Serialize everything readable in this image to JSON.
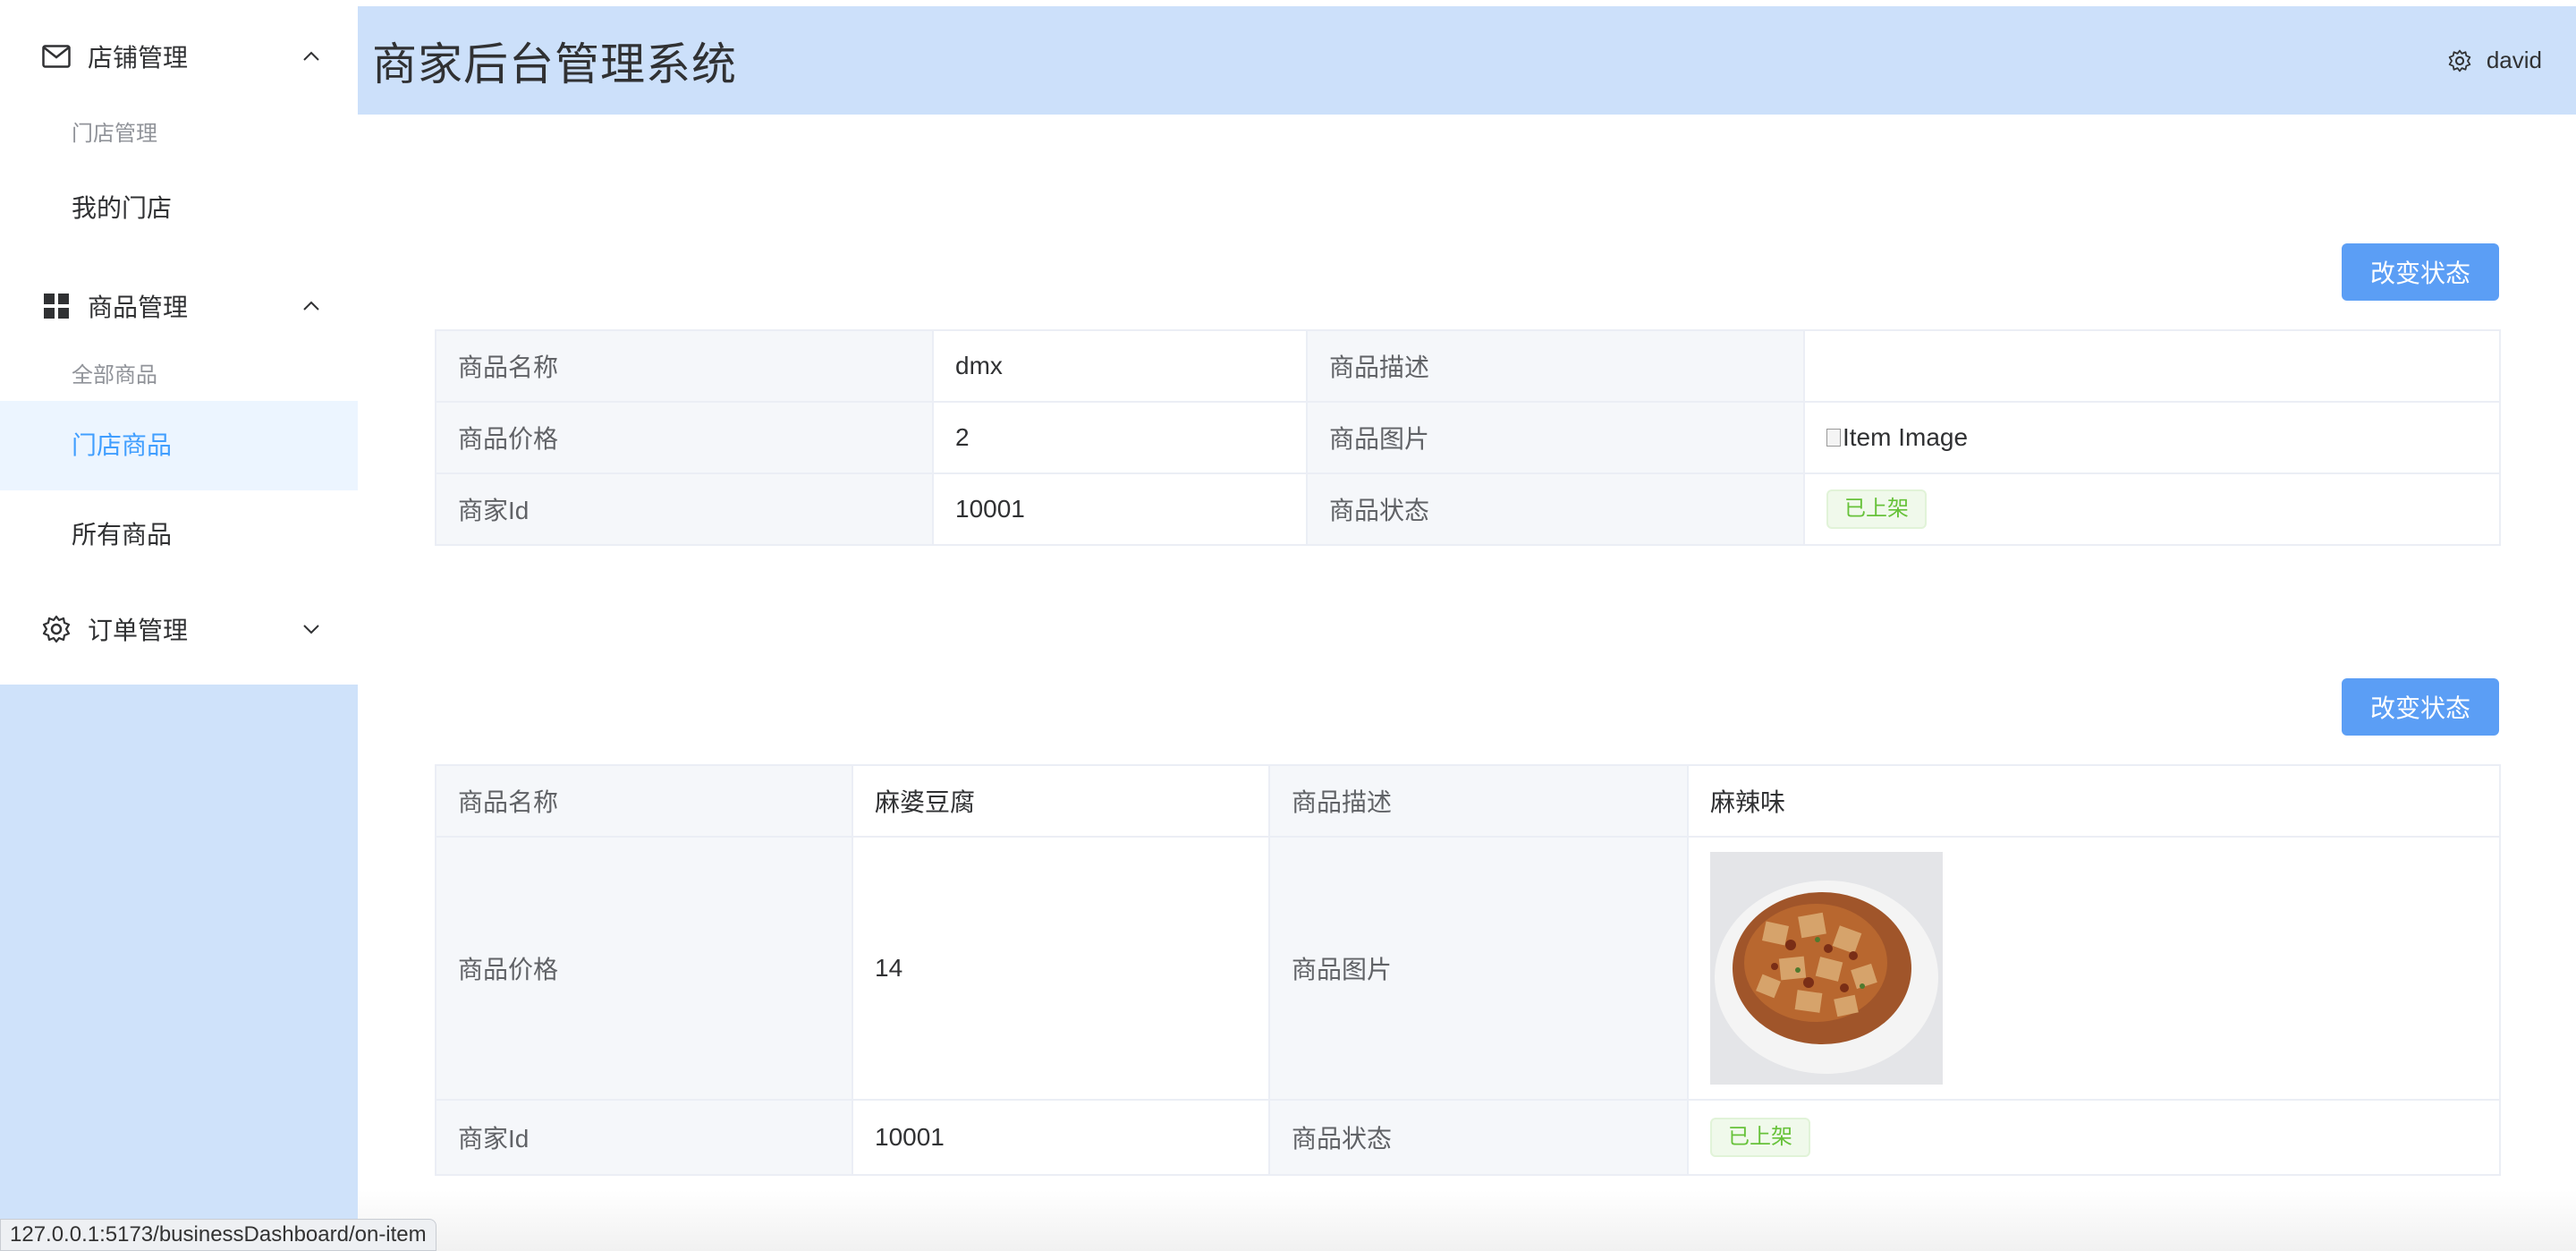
{
  "app": {
    "title": "商家后台管理系统",
    "user": "david"
  },
  "sidebar": {
    "groups": [
      {
        "label": "店铺管理",
        "icon": "mail-icon",
        "expanded": true,
        "subtitle": "门店管理",
        "items": [
          {
            "label": "我的门店",
            "active": false
          }
        ]
      },
      {
        "label": "商品管理",
        "icon": "grid-icon",
        "expanded": true,
        "subtitle": "全部商品",
        "items": [
          {
            "label": "门店商品",
            "active": true
          },
          {
            "label": "所有商品",
            "active": false
          }
        ]
      },
      {
        "label": "订单管理",
        "icon": "gear-icon",
        "expanded": false
      }
    ]
  },
  "labels": {
    "name": "商品名称",
    "desc": "商品描述",
    "price": "商品价格",
    "image": "商品图片",
    "merchant": "商家Id",
    "status": "商品状态",
    "change_status": "改变状态"
  },
  "products": [
    {
      "name": "dmx",
      "desc": "",
      "price": "2",
      "image_alt": "Item Image",
      "merchant_id": "10001",
      "status": "已上架"
    },
    {
      "name": "麻婆豆腐",
      "desc": "麻辣味",
      "price": "14",
      "image_alt": "mapo tofu dish photo",
      "merchant_id": "10001",
      "status": "已上架"
    }
  ],
  "statusbar_url": "127.0.0.1:5173/businessDashboard/on-item",
  "colors": {
    "sidebar_bg": "#cfe2fa",
    "header_bg": "#cce0fa",
    "accent": "#409eff",
    "button": "#5b9ef5",
    "tag_green": "#67c23a"
  }
}
